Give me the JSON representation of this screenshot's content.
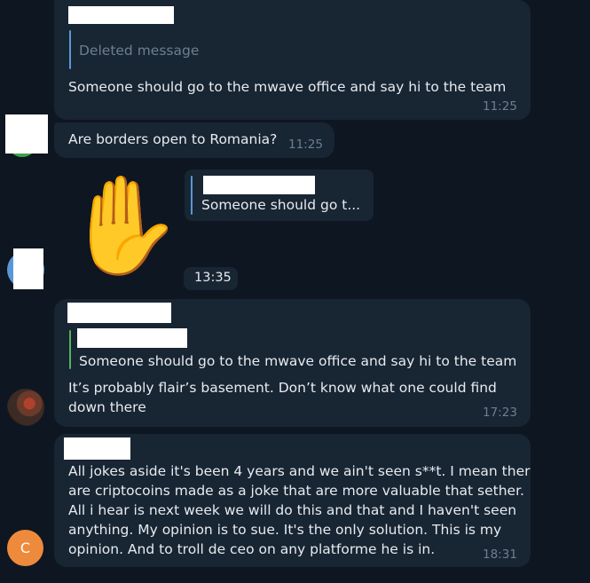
{
  "messages": [
    {
      "reply_label": "Deleted message",
      "text": "Someone should go to the mwave office and say hi to the team",
      "time": "11:25"
    },
    {
      "text": "Are borders open to Romania?",
      "time": "11:25"
    },
    {
      "sticker_emoji": "✋",
      "reply_preview": "Someone should go t...",
      "time": "13:35"
    },
    {
      "quote": "Someone should go to the mwave office and say hi to the team",
      "lines": [
        "It’s probably flair’s basement. Don’t know what one could find",
        "down there"
      ],
      "time": "17:23"
    },
    {
      "lines": [
        "All jokes aside it's been 4 years and we ain't seen s**t. I mean ther",
        "are criptocoins made as a joke that are more valuable that sether.",
        "All i hear is next week we will do this and that and I haven't seen",
        "anything. My opinion is to sue. It's  the only solution. This is my",
        "opinion. And to troll de ceo on any platforme he is in."
      ],
      "time": "18:31",
      "avatar_initial": "C"
    }
  ],
  "colors": {
    "background": "#0e1621",
    "bubble": "#182533",
    "reply_bar_blue": "#5a97d6",
    "reply_bar_green": "#55b35d",
    "avatar_orange": "#ee8a3c"
  }
}
